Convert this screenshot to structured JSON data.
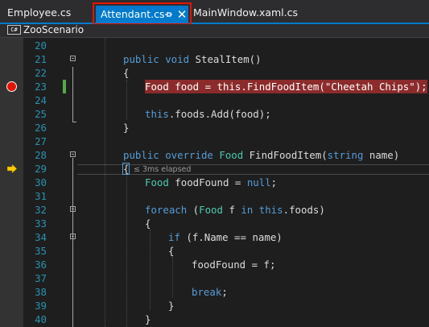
{
  "tabs": {
    "employee": "Employee.cs",
    "attendant": "Attendant.cs",
    "mainwindow": "MainWindow.xaml.cs",
    "pin_glyph": "⊓",
    "close_glyph": "✕"
  },
  "navbar": {
    "icon_text": "C#",
    "scope": "ZooScenario"
  },
  "perf_tip": "≤ 3ms elapsed",
  "colors": {
    "accent": "#007acc",
    "highlight_box": "#e51400",
    "breakpoint": "#e51400",
    "breakpoint_line": "#8b2b2b",
    "keyword": "#569cd6",
    "type": "#4ec9b0",
    "string": "#d69d85",
    "line_number": "#2b91af",
    "change_bar": "#57a64a",
    "execution_arrow": "#ffcc00"
  },
  "line_numbers": [
    "20",
    "21",
    "22",
    "23",
    "24",
    "25",
    "26",
    "27",
    "28",
    "29",
    "30",
    "31",
    "32",
    "33",
    "34",
    "35",
    "36",
    "37",
    "38",
    "39",
    "40"
  ],
  "code": {
    "l21": {
      "kw": "public void",
      "rest": " StealItem()"
    },
    "l22": "{",
    "l23": {
      "type": "Food",
      "a": " food = ",
      "kw": "this",
      "b": ".FindFoodItem(",
      "str": "\"Cheetah Chips\"",
      "c": ");"
    },
    "l25": {
      "kw": "this",
      "rest": ".foods.Add(food);"
    },
    "l26": "}",
    "l28": {
      "kw": "public override",
      "sp": " ",
      "type": "Food",
      "a": " FindFoodItem(",
      "kw2": "string",
      "b": " name)"
    },
    "l29": "{",
    "l30": {
      "type": "Food",
      "a": " foodFound = ",
      "kw": "null",
      "b": ";"
    },
    "l32": {
      "kw": "foreach",
      "a": " (",
      "type": "Food",
      "b": " f ",
      "kw2": "in",
      "c": " ",
      "kw3": "this",
      "d": ".foods)"
    },
    "l33": "{",
    "l34": {
      "kw": "if",
      "rest": " (f.Name == name)"
    },
    "l35": "{",
    "l36": "foodFound = f;",
    "l38": {
      "kw": "break",
      "rest": ";"
    },
    "l39": "}",
    "l40": "}"
  }
}
